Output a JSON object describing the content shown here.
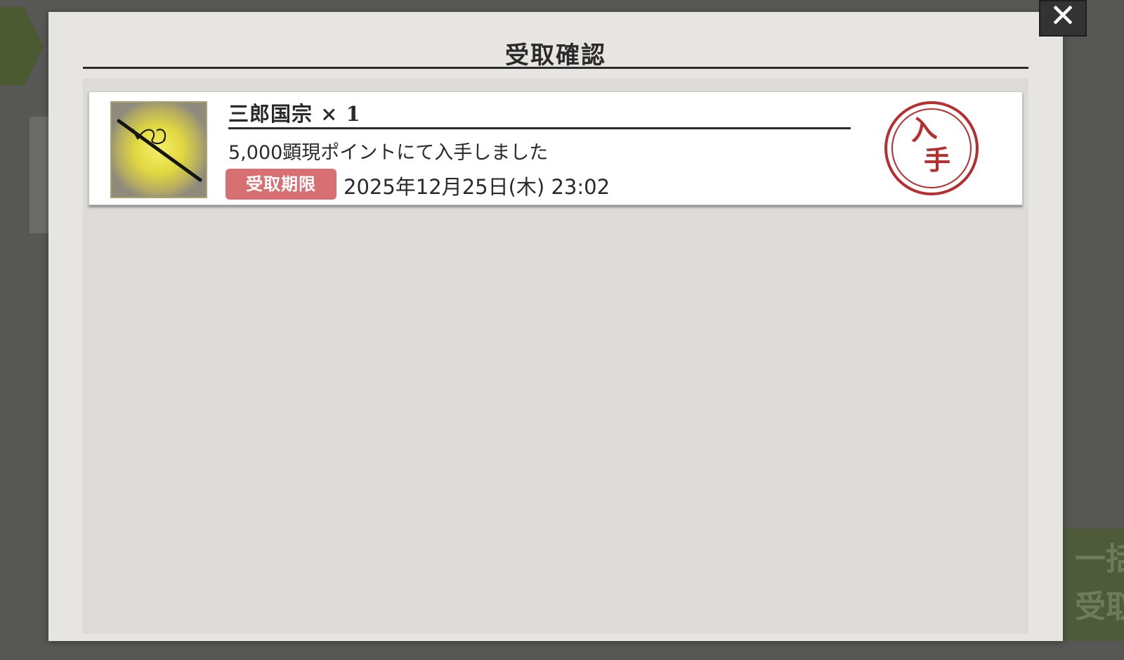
{
  "background": {
    "right_button_lines": [
      "一括",
      "受取"
    ]
  },
  "dialog": {
    "title": "受取確認",
    "close_icon": "close-icon"
  },
  "items": [
    {
      "name": "三郎国宗 × 1",
      "thumbnail_icon": "katana-icon",
      "description": "5,000顕現ポイントにて入手しました",
      "deadline_label": "受取期限",
      "deadline_value": "2025年12月25日(木) 23:02",
      "stamp_lines": [
        "入",
        "手"
      ]
    }
  ],
  "colors": {
    "dialog_bg": "#e6e5e1",
    "list_bg": "#dcdbd8",
    "badge_bg": "#d86f72",
    "stamp": "#b82e2e",
    "close_bg": "#333333"
  }
}
